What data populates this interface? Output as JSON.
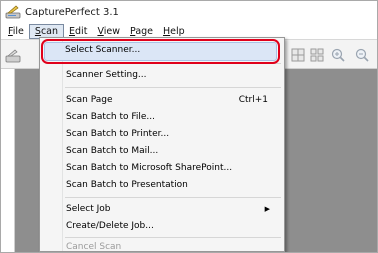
{
  "window": {
    "title": "CapturePerfect 3.1"
  },
  "menubar": {
    "items": [
      {
        "label": "File",
        "mnemonic": "F"
      },
      {
        "label": "Scan",
        "mnemonic": "S"
      },
      {
        "label": "Edit",
        "mnemonic": "E"
      },
      {
        "label": "View",
        "mnemonic": "V"
      },
      {
        "label": "Page",
        "mnemonic": "P"
      },
      {
        "label": "Help",
        "mnemonic": "H"
      }
    ]
  },
  "scan_menu": {
    "items": [
      {
        "label": "Select Scanner...",
        "highlighted": true
      },
      {
        "label": "Scanner Setting..."
      },
      {
        "label": "Scan Page",
        "shortcut": "Ctrl+1"
      },
      {
        "label": "Scan Batch to File..."
      },
      {
        "label": "Scan Batch to Printer..."
      },
      {
        "label": "Scan Batch to Mail..."
      },
      {
        "label": "Scan Batch to Microsoft SharePoint..."
      },
      {
        "label": "Scan Batch to Presentation"
      },
      {
        "label": "Select Job",
        "submenu": true
      },
      {
        "label": "Create/Delete Job..."
      },
      {
        "label": "Cancel Scan",
        "disabled": true
      }
    ]
  },
  "colors": {
    "callout_border": "#e0001b",
    "canvas_gray": "#8e8e8e",
    "menu_bg": "#f5f5f5"
  },
  "icons": {
    "app": "scanner-app-icon",
    "submenu": "triangle-right-icon",
    "toolbar": [
      "scan-icon",
      "layout-grid-icon",
      "layout-thumbs-icon",
      "zoom-in-icon",
      "zoom-out-icon"
    ]
  }
}
